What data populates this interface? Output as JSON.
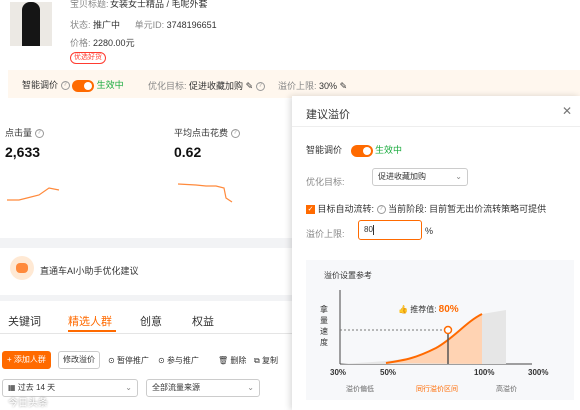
{
  "product": {
    "title_fragment": "女装女士精品 / 毛呢外套",
    "title_prefix": "宝贝标题:",
    "status_label": "状态:",
    "status_value": "推广中",
    "unit_label": "单元ID:",
    "unit_value": "3748196651",
    "price_label": "价格:",
    "price_value": "2280.00元",
    "tag": "优选好货"
  },
  "settings_bar": {
    "smart_bid_label": "智能调价",
    "smart_bid_status": "生效中",
    "goal_label": "优化目标:",
    "goal_value": "促进收藏加购",
    "cap_label": "溢价上限:",
    "cap_value": "30%"
  },
  "metrics": [
    {
      "label": "点击量",
      "value": "2,633"
    },
    {
      "label": "平均点击花费",
      "value": "0.62"
    }
  ],
  "ai_banner": {
    "text": "直通车AI小助手优化建议"
  },
  "tabs": [
    "关键词",
    "精选人群",
    "创意",
    "权益"
  ],
  "active_tab": "精选人群",
  "toolbar": {
    "add_crowd": "+ 添加人群",
    "modify_bid": "修改溢价",
    "pause": "暂停推广",
    "join": "参与推广",
    "delete": "删除",
    "copy": "复制"
  },
  "filters": {
    "period": "过去 14 天",
    "traffic": "全部流量来源"
  },
  "modal": {
    "title": "建议溢价",
    "smart_bid_label": "智能调价",
    "smart_bid_status": "生效中",
    "goal_label": "优化目标:",
    "goal_value": "促进收藏加购",
    "auto_flow_label": "目标自动流转:",
    "auto_flow_note": "当前阶段: 目前暂无出价流转策略可提供",
    "cap_label": "溢价上限:",
    "cap_input": "80",
    "cap_unit": "%",
    "ref_title": "溢价设置参考",
    "recommend_label": "推荐值:",
    "recommend_value": "80%",
    "y_axis": [
      "拿",
      "量",
      "速",
      "度"
    ],
    "x_ticks": [
      "30%",
      "50%",
      "100%",
      "300%"
    ],
    "legend": [
      "溢价偏低",
      "同行溢价区间",
      "高溢价"
    ]
  },
  "watermark": "今日头条"
}
